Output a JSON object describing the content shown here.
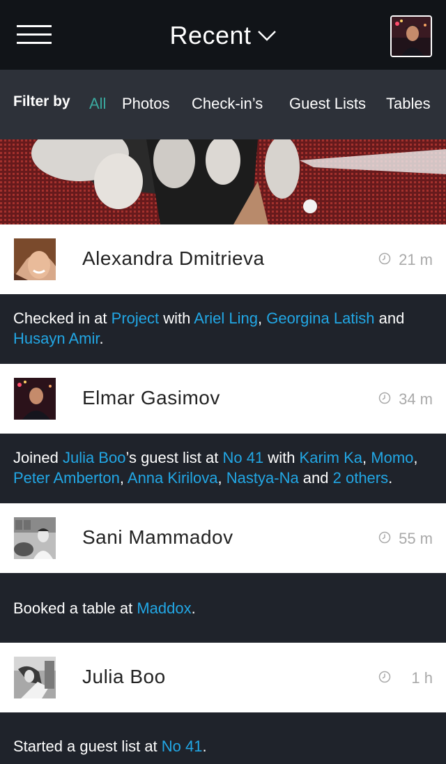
{
  "header": {
    "title": "Recent"
  },
  "filter": {
    "label": "Filter by",
    "tabs": [
      "All",
      "Photos",
      "Check-in’s",
      "Guest Lists",
      "Tables"
    ],
    "active": "All"
  },
  "feed": [
    {
      "name": "Alexandra Dmitrieva",
      "time": "21 m",
      "activity": [
        "Checked in at ",
        {
          "link": "Project"
        },
        " with ",
        {
          "link": "Ariel Ling"
        },
        ", ",
        {
          "link": "Georgina Latish"
        },
        " and ",
        {
          "link": "Husayn Amir"
        },
        "."
      ]
    },
    {
      "name": "Elmar Gasimov",
      "time": "34 m",
      "activity": [
        "Joined ",
        {
          "link": "Julia Boo"
        },
        "’s guest list at ",
        {
          "link": "No 41"
        },
        " with ",
        {
          "link": "Karim Ka"
        },
        ", ",
        {
          "link": "Momo"
        },
        ", ",
        {
          "link": "Peter Amberton"
        },
        ", ",
        {
          "link": "Anna Kirilova"
        },
        ", ",
        {
          "link": "Nastya-Na"
        },
        " and ",
        {
          "link": "2 others"
        },
        "."
      ]
    },
    {
      "name": "Sani Mammadov",
      "time": "55 m",
      "activity": [
        "Booked a table at ",
        {
          "link": "Maddox"
        },
        "."
      ]
    },
    {
      "name": "Julia Boo",
      "time": "1 h",
      "activity": [
        "Started a guest list at ",
        {
          "link": "No 41"
        },
        "."
      ]
    }
  ],
  "colors": {
    "link": "#22a7e5",
    "active_filter": "#3aa99f",
    "topbar": "#111418",
    "filterbar": "#2d3139",
    "body": "#1f232b"
  },
  "icons": [
    "hamburger-menu-icon",
    "chevron-down-icon",
    "clock-icon"
  ]
}
